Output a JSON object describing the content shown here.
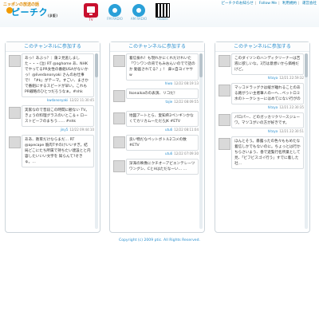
{
  "header": {
    "logo_tag": "ニッポンの放送の話",
    "logo_name": "ピーチク",
    "logo_suffix": "(β版)",
    "nav": [
      {
        "label": "TV",
        "icon": "tv-icon"
      },
      {
        "label": "FM RADIO",
        "icon": "radio-icon"
      },
      {
        "label": "AM RADIO",
        "icon": "radio-icon"
      },
      {
        "label": "mobile",
        "icon": "qr-code-icon"
      }
    ],
    "links": [
      "ピーチクのお知らせ",
      "Follow Me",
      "利用規約",
      "運営会社"
    ]
  },
  "columns": [
    {
      "title": "このチャンネルに参加する",
      "posts": [
        {
          "text": "あっ！あぶっ？：蒲２見逃しました・・・(泣) RT @aghome あ、NHKでやってるPR女性の番組USAがないかっ！@livedanonyaki さんのお仕事で！「#k」がテーマ。すごい、まさかで番組にするスピードが早い。これもPR戦略のひとつだろうなぁ。#nhk",
          "user": "kwdanonyaki",
          "time": "12/22 11:30:45"
        },
        {
          "text": "実家なので普段この時間に観ない TV。きょうの料理グラスのいとこ＆+ ローストビーフのまちう…… #nhk",
          "user": "jiny5",
          "time": "12/22 09:44:10"
        },
        {
          "text": "ああ、教育だけならまだ… RT @apecape 筋肉Tすのけいいすぎ。結局どこにたち所属で持ちたい建設とと内容したいいい文字を 知らんて?ぞきゅ。…"
        }
      ]
    },
    {
      "title": "このチャンネルに参加する",
      "posts": [
        {
          "text": "着信振れ！も現れかにくれだけれいた「ワンワンの背でもみおんいのでで話のか 動画されてる？」！ 鼻×自ヨイヤサ w",
          "user": "hiwa",
          "time": "12/22 08:19:13"
        },
        {
          "text": "Ikonaikaのの表演、リコだ！",
          "user": "tajie",
          "time": "12/22 08:09:55"
        },
        {
          "text": "地図アートとら、愛知県2ペンギンかなくてカリカム一ただろJK #ETV",
          "user": "utu6",
          "time": "12/22 08:11:04"
        },
        {
          "text": "良い物だなペットボトル2コメの数 #ETV",
          "user": "utu6",
          "time": "12/22 07:09:30"
        },
        {
          "text": "深海の映像にクチオーアビエンテレーツワングシ、CとHはただなーい… …"
        }
      ]
    },
    {
      "title": "このチャンネルに参加する",
      "posts": [
        {
          "text": "このダイソンのハンディクリーナーは吉液に欲しいな。3万は意想いから価格だけど。",
          "user": "hitoya",
          "time": "12/21 22:59:32"
        },
        {
          "text": "マッコドラッグクは縦が離れることのある路がうい主者筆人の一へ...ペットロミ水のトークショーにはめてにない行がの",
          "user": "hitoya",
          "time": "12/21 22:30:35"
        },
        {
          "text": "パロパー、どのガッカリクリースジューワ。マツコがいの方が好きです。",
          "user": "hitoya",
          "time": "12/21 22:30:51"
        },
        {
          "text": "ほんとそう。暴露ったの色々ももめたな着信しかでもないのに。ちょっとは行かちらさいよう、香で遊覧行名所業として見、「ビフビスゴイ行う」すでに着した社…"
        }
      ]
    }
  ],
  "footer": {
    "copyright": "Copyright (c) 2009 ptic. All Rights Reserved."
  },
  "colors": {
    "accent": "#2a8fcf",
    "active": "#c8102e",
    "logo": "#0090d0"
  }
}
